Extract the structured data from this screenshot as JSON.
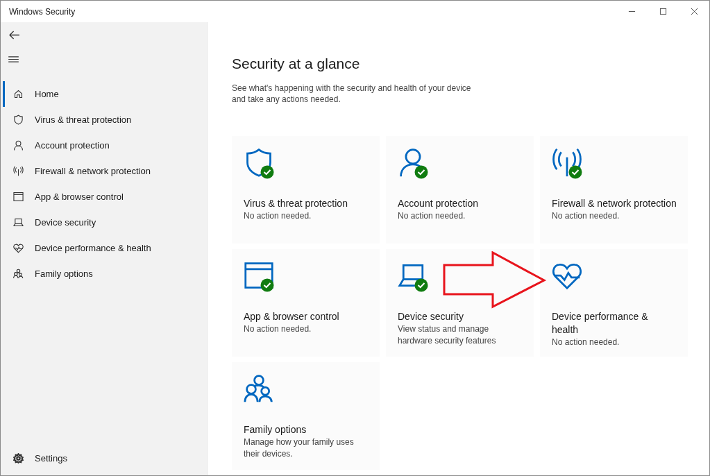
{
  "window": {
    "title": "Windows Security"
  },
  "sidebar": {
    "items": [
      {
        "label": "Home",
        "kind": "home",
        "selected": true
      },
      {
        "label": "Virus & threat protection",
        "kind": "shield",
        "selected": false
      },
      {
        "label": "Account protection",
        "kind": "person",
        "selected": false
      },
      {
        "label": "Firewall & network protection",
        "kind": "antenna",
        "selected": false
      },
      {
        "label": "App & browser control",
        "kind": "window",
        "selected": false
      },
      {
        "label": "Device security",
        "kind": "laptop",
        "selected": false
      },
      {
        "label": "Device performance & health",
        "kind": "heart",
        "selected": false
      },
      {
        "label": "Family options",
        "kind": "family",
        "selected": false
      }
    ],
    "settings": {
      "label": "Settings"
    }
  },
  "main": {
    "title": "Security at a glance",
    "subtitle": "See what's happening with the security and health of your device and take any actions needed.",
    "tiles": [
      {
        "title": "Virus & threat protection",
        "status": "No action needed.",
        "kind": "shield",
        "ok": true
      },
      {
        "title": "Account protection",
        "status": "No action needed.",
        "kind": "person",
        "ok": true
      },
      {
        "title": "Firewall & network protection",
        "status": "No action needed.",
        "kind": "antenna",
        "ok": true
      },
      {
        "title": "App & browser control",
        "status": "No action needed.",
        "kind": "window",
        "ok": true
      },
      {
        "title": "Device security",
        "status": "View status and manage hardware security features",
        "kind": "laptop",
        "ok": true
      },
      {
        "title": "Device performance & health",
        "status": "No action needed.",
        "kind": "heart",
        "ok": false
      },
      {
        "title": "Family options",
        "status": "Manage how your family uses their devices.",
        "kind": "family",
        "ok": false
      }
    ]
  }
}
